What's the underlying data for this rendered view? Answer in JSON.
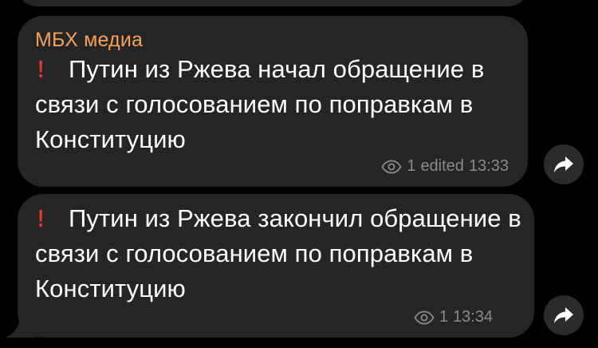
{
  "colors": {
    "background": "#000000",
    "bubble": "#252525",
    "sender": "#f4a05b",
    "text": "#ffffff",
    "meta": "#8a8a8a",
    "exclamation": "#e03a2e",
    "forward_button": "#2b2b2b"
  },
  "messages": [
    {
      "sender": "МБХ медиа",
      "icon": "exclamation-icon",
      "icon_glyph": "!",
      "text": "Путин из Ржева начал обращение в связи с голосованием по поправкам в Конституцию",
      "views": "1",
      "edited_label": "edited",
      "time": "13:33"
    },
    {
      "icon": "exclamation-icon",
      "icon_glyph": "!",
      "text": "Путин из Ржева закончил обращение в связи с голосованием по поправкам в Конституцию",
      "views": "1",
      "time": "13:34"
    }
  ]
}
